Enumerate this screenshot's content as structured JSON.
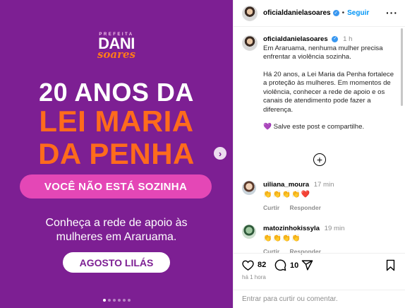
{
  "post_image": {
    "brand_top": "PREFEITA",
    "brand_name": "DANI",
    "brand_script": "soares",
    "headline_line1": "20 ANOS DA",
    "headline_line2": "LEI MARIA",
    "headline_line3": "DA PENHA",
    "pill_text": "VOCÊ NÃO ESTÁ SOZINHA",
    "subtext": "Conheça a rede de apoio às mulheres em Araruama.",
    "button_text": "AGOSTO LILÁS",
    "carousel_slides": 6,
    "carousel_active": 1,
    "colors": {
      "background": "#7d1f93",
      "orange": "#ff6b1c",
      "pink": "#e447b6"
    }
  },
  "header": {
    "username": "oficialdanielasoares",
    "separator": "•",
    "follow_label": "Seguir",
    "more_label": "···"
  },
  "caption": {
    "username": "oficialdanielasoares",
    "time": "1 h",
    "paragraph1": "Em Araruama, nenhuma mulher precisa enfrentar a violência sozinha.",
    "paragraph2": "Há 20 anos, a Lei Maria da Penha fortalece a proteção às mulheres. Em momentos de violência, conhecer a rede de apoio e os canais de atendimento pode fazer a diferença.",
    "paragraph3": "💜 Salve este post e compartilhe."
  },
  "comments": [
    {
      "user": "uiliana_moura",
      "time": "17 min",
      "text": "👏👏👏👏❤️",
      "reply_label": "Curtir",
      "respond_label": "Responder"
    },
    {
      "user": "matozinhokissyla",
      "time": "19 min",
      "text": "👏👏👏👏",
      "reply_label": "Curtir",
      "respond_label": "Responder"
    }
  ],
  "actions": {
    "likes": "82",
    "comments": "10",
    "posted": "há 1 hora"
  },
  "footer": {
    "placeholder": "Entrar para curtir ou comentar."
  }
}
